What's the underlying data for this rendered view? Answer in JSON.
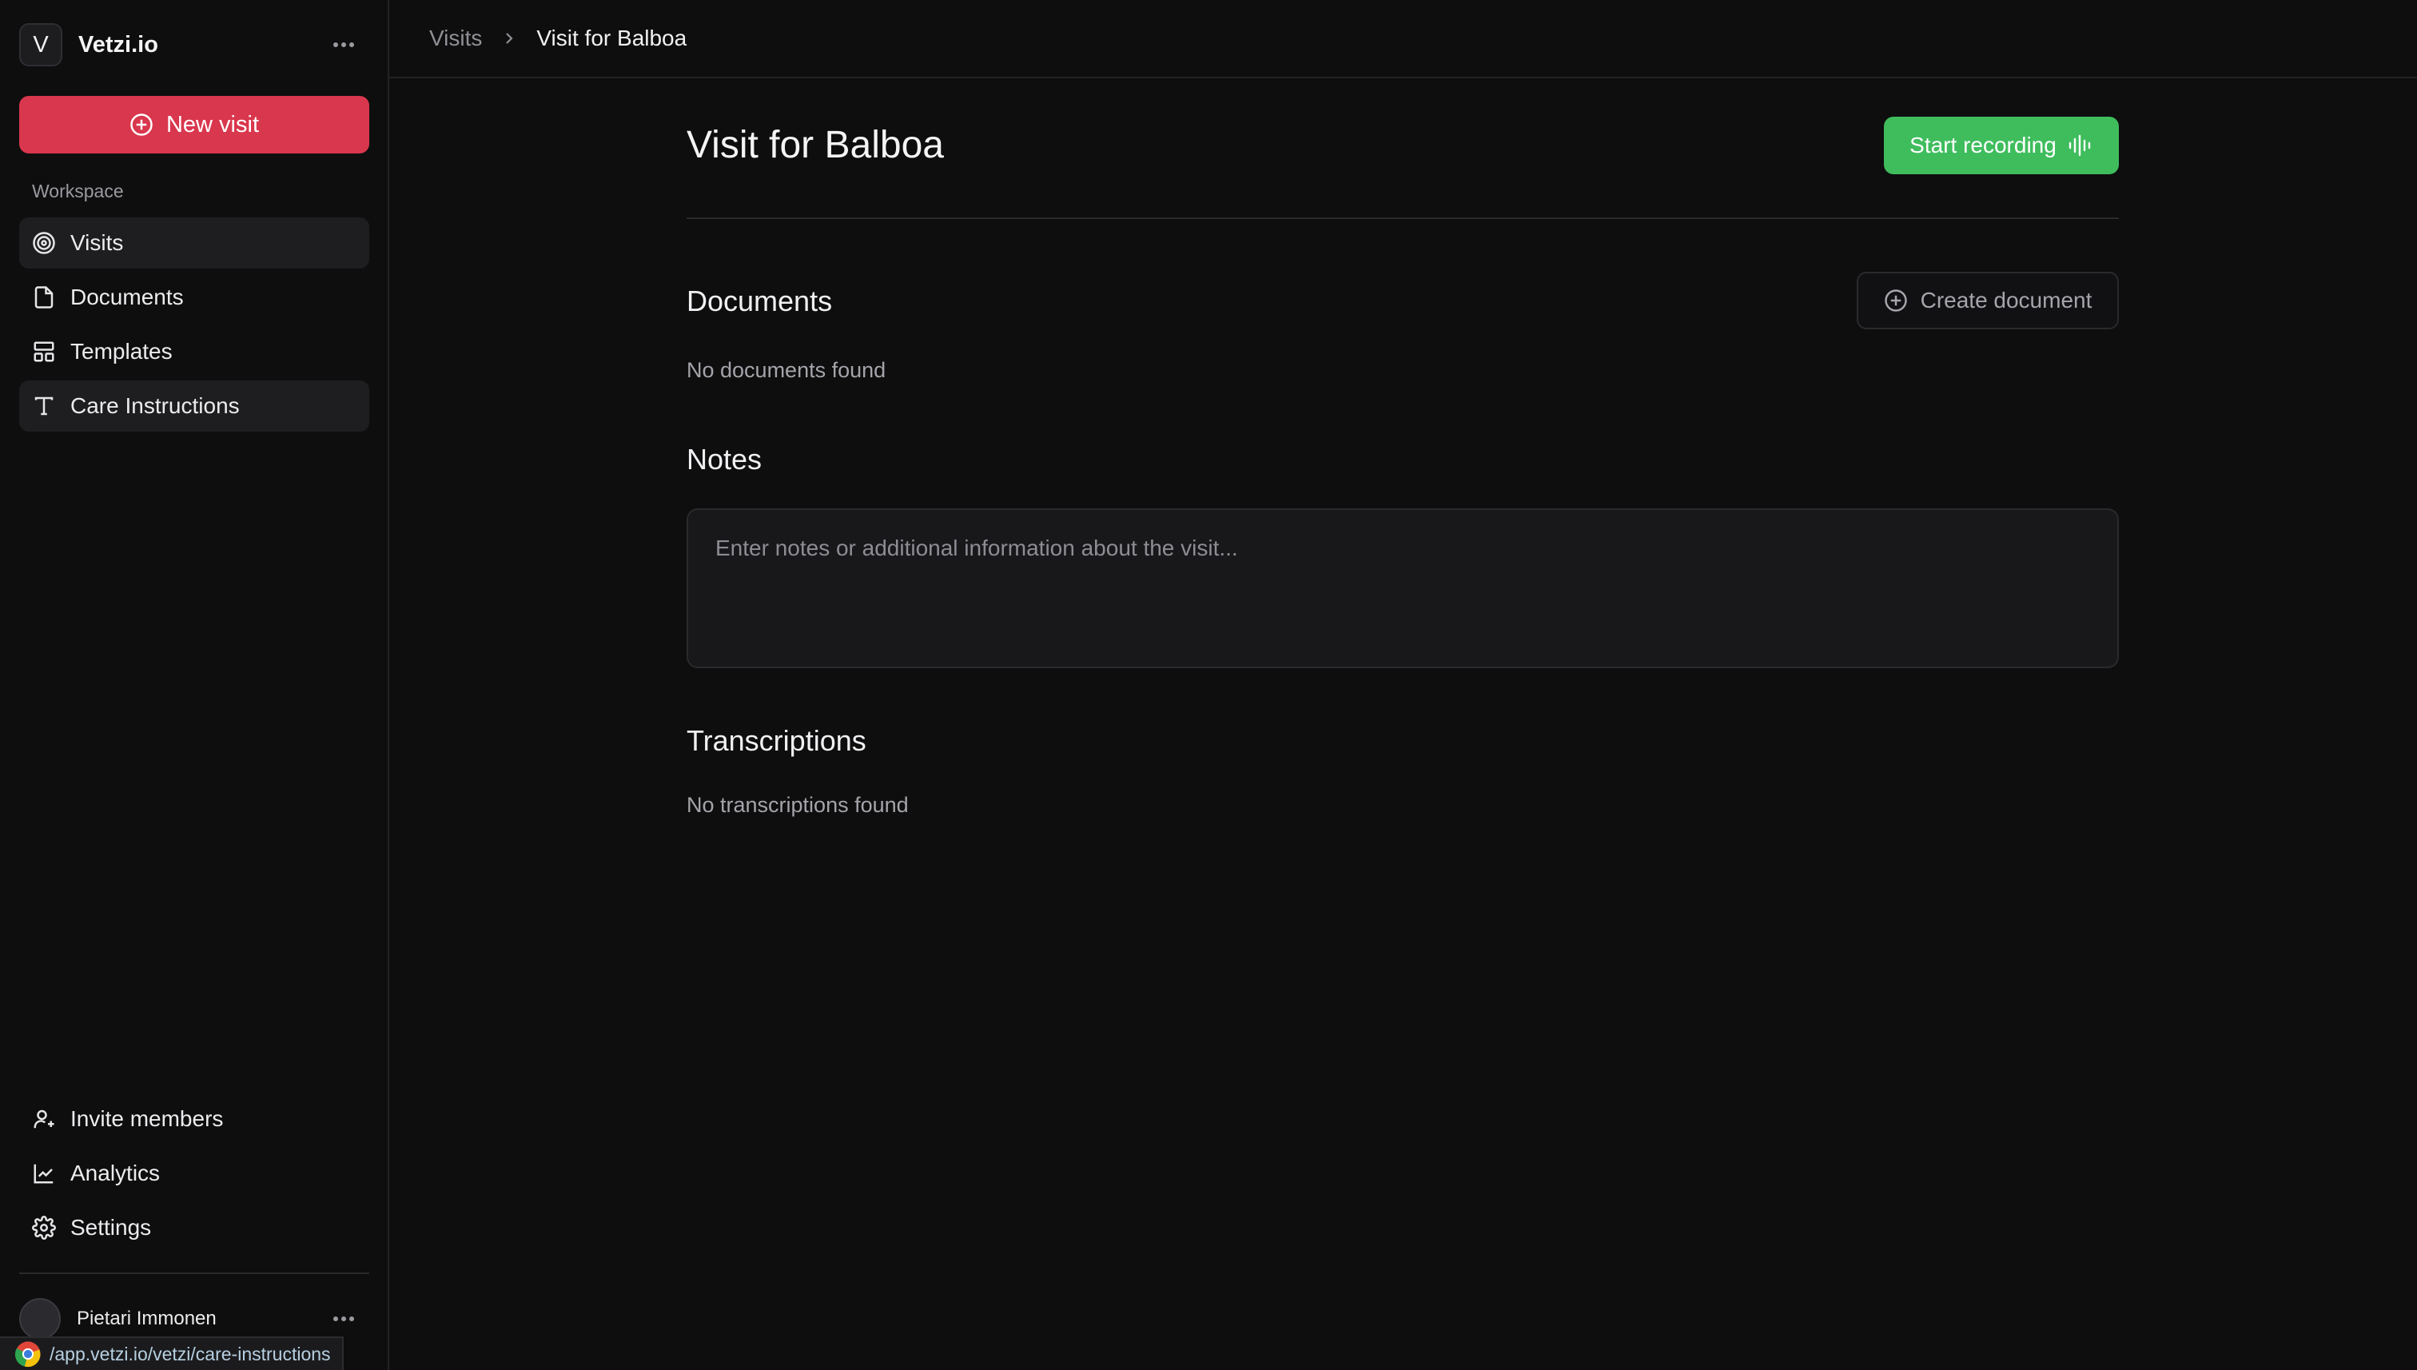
{
  "workspace": {
    "logo_letter": "V",
    "name": "Vetzi.io"
  },
  "sidebar": {
    "new_visit_label": "New visit",
    "section_label": "Workspace",
    "items": [
      {
        "label": "Visits",
        "icon": "target-icon",
        "active": true
      },
      {
        "label": "Documents",
        "icon": "file-icon",
        "active": false
      },
      {
        "label": "Templates",
        "icon": "layout-icon",
        "active": false
      },
      {
        "label": "Care Instructions",
        "icon": "text-icon",
        "active": true
      }
    ],
    "bottom_items": [
      {
        "label": "Invite members",
        "icon": "user-plus-icon"
      },
      {
        "label": "Analytics",
        "icon": "line-chart-icon"
      },
      {
        "label": "Settings",
        "icon": "gear-icon"
      }
    ],
    "user_name": "Pietari Immonen"
  },
  "status_bar": {
    "url": "/app.vetzi.io/vetzi/care-instructions"
  },
  "breadcrumb": {
    "parent": "Visits",
    "current": "Visit for Balboa"
  },
  "page": {
    "title": "Visit for Balboa",
    "start_recording_label": "Start recording",
    "documents": {
      "title": "Documents",
      "create_label": "Create document",
      "empty": "No documents found"
    },
    "notes": {
      "title": "Notes",
      "placeholder": "Enter notes or additional information about the visit..."
    },
    "transcriptions": {
      "title": "Transcriptions",
      "empty": "No transcriptions found"
    }
  },
  "colors": {
    "accent_red": "#d9374d",
    "accent_green": "#3fbd5d",
    "background": "#0e0e0f"
  }
}
